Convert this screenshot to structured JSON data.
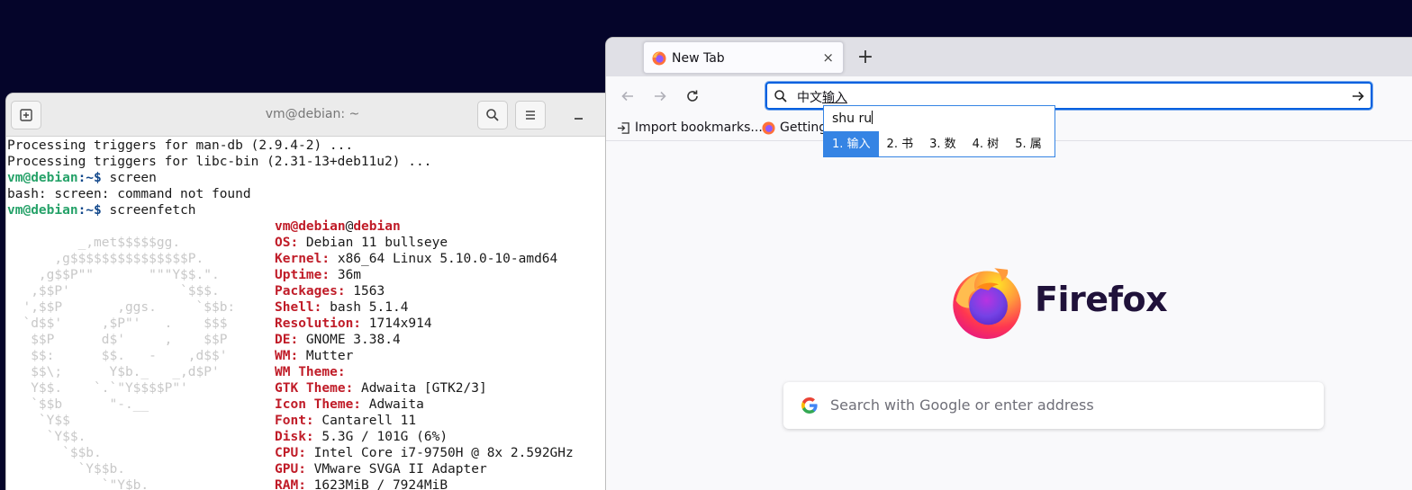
{
  "terminal": {
    "title": "vm@debian: ~",
    "lines": [
      "Processing triggers for man-db (2.9.4-2) ...",
      "Processing triggers for libc-bin (2.31-13+deb11u2) ...",
      "bash: screen: command not found"
    ],
    "prompt_user": "vm@debian",
    "prompt_suffix": ":~$ ",
    "cmd1": "screen",
    "cmd2": "screenfetch",
    "art": [
      "         _,met$$$$$gg.",
      "      ,g$$$$$$$$$$$$$$$P.",
      "    ,g$$P\"\"       \"\"\"Y$$.\".",
      "   ,$$P'              `$$$.",
      "  ',$$P       ,ggs.     `$$b:",
      "  `d$$'     ,$P\"'   .    $$$",
      "   $$P      d$'     ,    $$P",
      "   $$:      $$.   -    ,d$$'",
      "   $$\\;      Y$b._   _,d$P'",
      "   Y$$.    `.`\"Y$$$$P\"'",
      "   `$$b      \"-.__",
      "    `Y$$",
      "     `Y$$.",
      "       `$$b.",
      "         `Y$$b.",
      "            `\"Y$b._",
      "                `\"\"\"\""
    ],
    "host": "debian",
    "at": "@",
    "info": [
      {
        "k": "OS:",
        "v": " Debian 11 bullseye"
      },
      {
        "k": "Kernel:",
        "v": " x86_64 Linux 5.10.0-10-amd64"
      },
      {
        "k": "Uptime:",
        "v": " 36m"
      },
      {
        "k": "Packages:",
        "v": " 1563"
      },
      {
        "k": "Shell:",
        "v": " bash 5.1.4"
      },
      {
        "k": "Resolution:",
        "v": " 1714x914"
      },
      {
        "k": "DE:",
        "v": " GNOME 3.38.4"
      },
      {
        "k": "WM:",
        "v": " Mutter"
      },
      {
        "k": "WM Theme:",
        "v": ""
      },
      {
        "k": "GTK Theme:",
        "v": " Adwaita [GTK2/3]"
      },
      {
        "k": "Icon Theme:",
        "v": " Adwaita"
      },
      {
        "k": "Font:",
        "v": " Cantarell 11"
      },
      {
        "k": "Disk:",
        "v": " 5.3G / 101G (6%)"
      },
      {
        "k": "CPU:",
        "v": " Intel Core i7-9750H @ 8x 2.592GHz"
      },
      {
        "k": "GPU:",
        "v": " VMware SVGA II Adapter"
      },
      {
        "k": "RAM:",
        "v": " 1623MiB / 7924MiB"
      }
    ]
  },
  "firefox": {
    "tab_label": "New Tab",
    "tab_close": "×",
    "new_tab": "+",
    "url_prefix": "中文",
    "url_composing": "输入",
    "bookmarks": [
      "Import bookmarks...",
      "Getting"
    ],
    "wordmark": "Firefox",
    "search_placeholder": "Search with Google or enter address"
  },
  "ime": {
    "preedit": "shu ru",
    "candidates": [
      "1. 输入",
      "2. 书",
      "3. 数",
      "4. 树",
      "5. 属"
    ],
    "selected_index": 0
  },
  "colors": {
    "desktop": "#05052a",
    "prompt_green": "#26a269",
    "prompt_blue": "#12488b",
    "info_red": "#c01c28",
    "focus_blue": "#0060df",
    "ime_blue": "#3584e4"
  }
}
